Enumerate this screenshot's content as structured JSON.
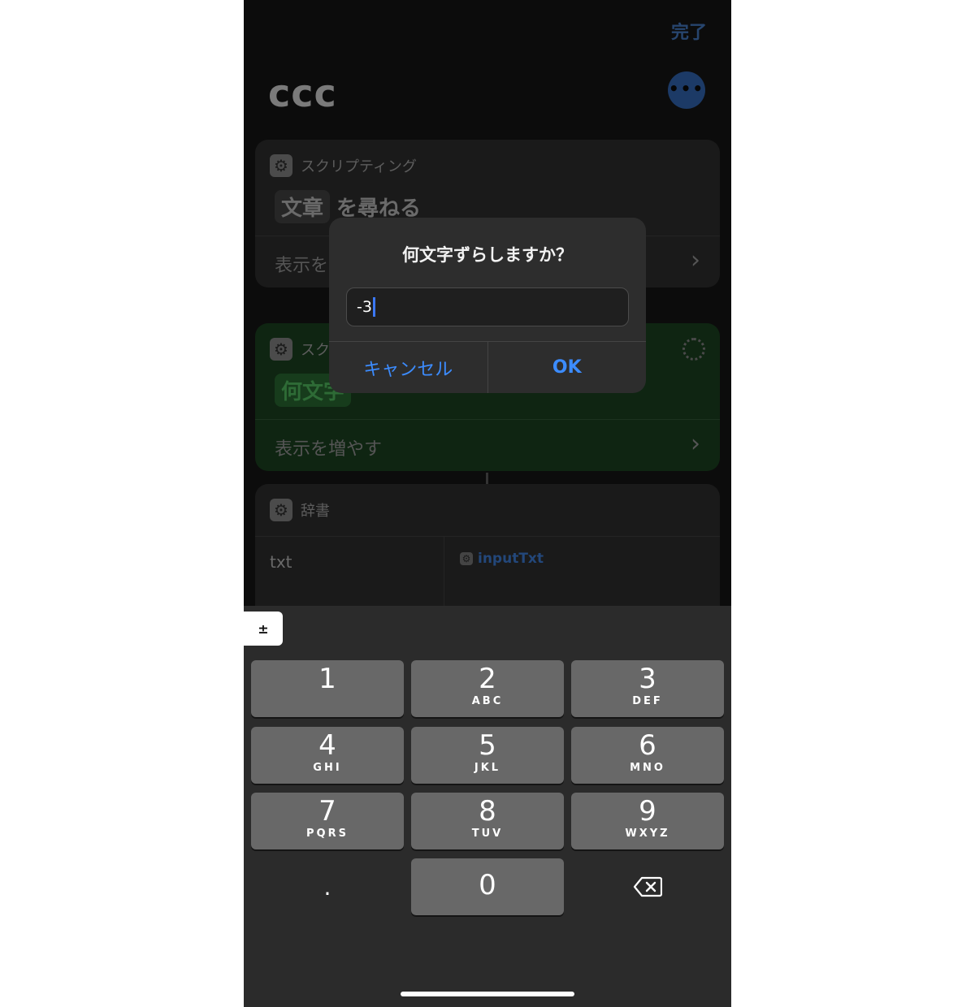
{
  "header": {
    "done_label": "完了",
    "title": "ccc",
    "more_label": "•••"
  },
  "cards": {
    "ask_text": {
      "category": "スクリプティング",
      "token": "文章",
      "suffix": "を尋ねる",
      "show_more": "表示を"
    },
    "ask_shift": {
      "category": "スク",
      "token": "何文字",
      "show_more": "表示を増やす"
    },
    "dictionary": {
      "category": "辞書",
      "key": "txt",
      "value": "inputTxt"
    }
  },
  "alert": {
    "title": "何文字ずらしますか？",
    "input_value": "-3",
    "cancel_label": "キャンセル",
    "ok_label": "OK"
  },
  "keyboard": {
    "plus_minus": "±",
    "keys": [
      {
        "num": "1",
        "letters": ""
      },
      {
        "num": "2",
        "letters": "ABC"
      },
      {
        "num": "3",
        "letters": "DEF"
      },
      {
        "num": "4",
        "letters": "GHI"
      },
      {
        "num": "5",
        "letters": "JKL"
      },
      {
        "num": "6",
        "letters": "MNO"
      },
      {
        "num": "7",
        "letters": "PQRS"
      },
      {
        "num": "8",
        "letters": "TUV"
      },
      {
        "num": "9",
        "letters": "WXYZ"
      },
      {
        "num": "0",
        "letters": ""
      }
    ],
    "decimal": "."
  },
  "colors": {
    "accent": "#3c8cff",
    "keyboard_bg": "#2b2b2b",
    "key_bg": "#686868"
  }
}
